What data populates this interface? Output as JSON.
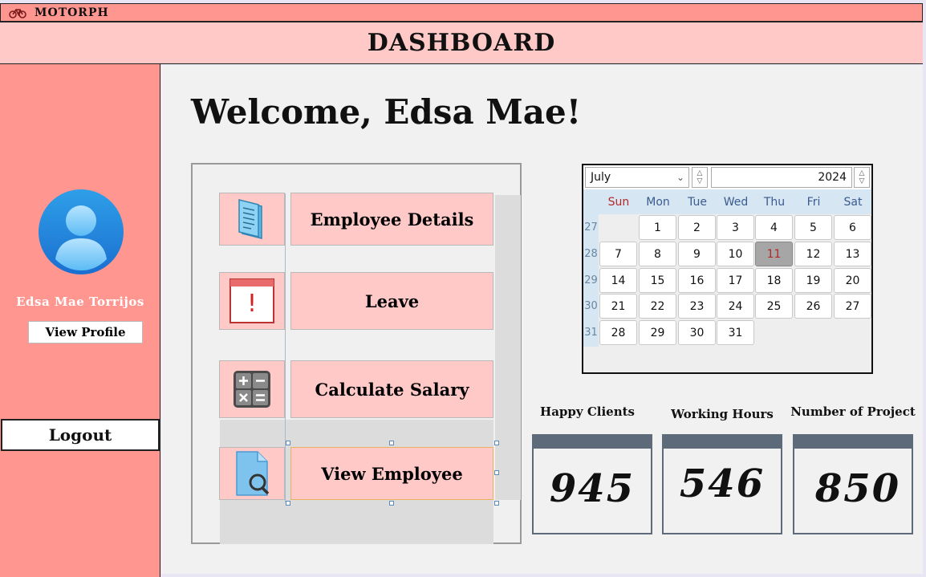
{
  "titlebar": {
    "app_title": "MOTORPH",
    "icon": "bike-icon"
  },
  "header": {
    "title": "DASHBOARD"
  },
  "sidebar": {
    "avatar_icon": "user-avatar-icon",
    "user_name": "Edsa Mae Torrijos",
    "view_profile_label": "View Profile",
    "logout_label": "Logout"
  },
  "main": {
    "welcome": "Welcome, Edsa Mae!",
    "menu": [
      {
        "label": "Employee Details",
        "icon": "document-icon"
      },
      {
        "label": "Leave",
        "icon": "calendar-alert-icon"
      },
      {
        "label": "Calculate Salary",
        "icon": "calculator-icon"
      },
      {
        "label": "View Employee",
        "icon": "file-search-icon"
      }
    ]
  },
  "calendar": {
    "month": "July",
    "year": "2024",
    "weekdays": [
      "Sun",
      "Mon",
      "Tue",
      "Wed",
      "Thu",
      "Fri",
      "Sat"
    ],
    "week_numbers": [
      "27",
      "28",
      "29",
      "30",
      "31"
    ],
    "weeks": [
      [
        "",
        "1",
        "2",
        "3",
        "4",
        "5",
        "6"
      ],
      [
        "7",
        "8",
        "9",
        "10",
        "11",
        "12",
        "13"
      ],
      [
        "14",
        "15",
        "16",
        "17",
        "18",
        "19",
        "20"
      ],
      [
        "21",
        "22",
        "23",
        "24",
        "25",
        "26",
        "27"
      ],
      [
        "28",
        "29",
        "30",
        "31",
        "",
        "",
        ""
      ]
    ],
    "selected_day": "11"
  },
  "stats": [
    {
      "label": "Happy Clients",
      "value": "945"
    },
    {
      "label": "Working Hours",
      "value": "546"
    },
    {
      "label": "Number of Project",
      "value": "850"
    }
  ],
  "colors": {
    "titlebar": "#ff9690",
    "header": "#ffc9c8",
    "sidebar": "#ff9690",
    "menu_button": "#ffc9c8",
    "stat_bar": "#5c6a7a"
  }
}
